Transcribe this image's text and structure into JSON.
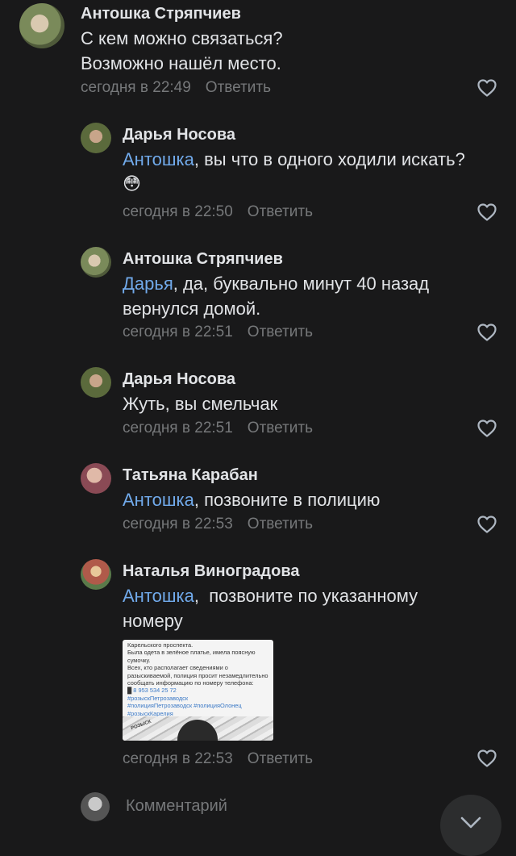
{
  "comments": [
    {
      "author": "Антошка Стряпчиев",
      "text_line1": "С кем можно связаться?",
      "text_line2": "Возможно нашёл место.",
      "time": "сегодня в 22:49",
      "reply_label": "Ответить"
    },
    {
      "author": "Дарья Носова",
      "mention": "Антошка",
      "text": ", вы что в одного ходили искать?",
      "emoji": "😳",
      "time": "сегодня в 22:50",
      "reply_label": "Ответить"
    },
    {
      "author": "Антошка Стряпчиев",
      "mention": "Дарья",
      "text": ", да, буквально минут 40 назад вернулся домой.",
      "time": "сегодня в 22:51",
      "reply_label": "Ответить"
    },
    {
      "author": "Дарья Носова",
      "text": "Жуть, вы смельчак",
      "time": "сегодня в 22:51",
      "reply_label": "Ответить"
    },
    {
      "author": "Татьяна Карабан",
      "mention": "Антошка",
      "text": ", позвоните в полицию",
      "time": "сегодня в 22:53",
      "reply_label": "Ответить"
    },
    {
      "author": "Наталья Виноградова",
      "mention": "Антошка",
      "text": ",  позвоните по указанному номеру",
      "time": "сегодня в 22:53",
      "reply_label": "Ответить",
      "attachment": {
        "body": "Карельского проспекта.\nБыла одета в зелёное платье, имела поясную сумочку.\nВсех, кто располагает сведениями о разыскиваемой, полиция просит незамедлительно сообщать информацию по номеру телефона:",
        "phone": "8 953 534 25 72",
        "tags": "#розыскПетрозаводск\n#полицияПетрозаводск #полицияОлонец\n#розыскКарелия",
        "strip_text": "РОЗЫСК"
      }
    }
  ],
  "composer": {
    "placeholder": "Комментарий"
  },
  "colors": {
    "background": "#19191a",
    "text": "#e1e3e6",
    "secondary": "#76787a",
    "mention": "#71aaeb"
  },
  "icons": {
    "like": "heart-outline-icon",
    "scroll": "chevron-down-icon"
  }
}
